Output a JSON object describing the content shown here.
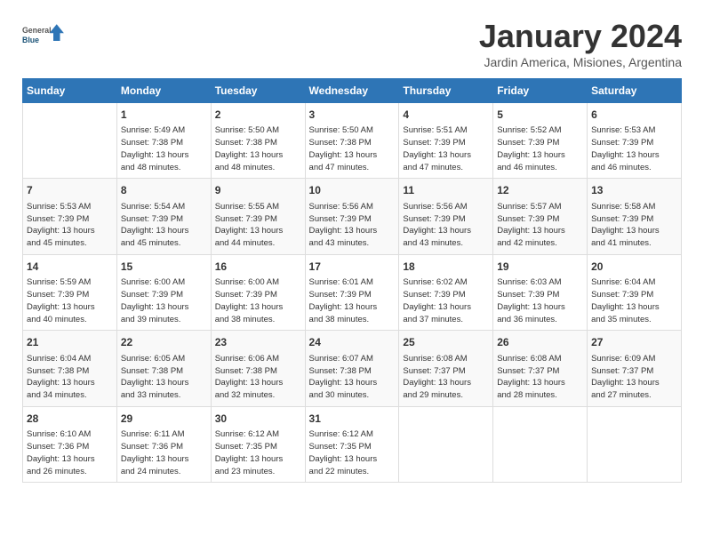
{
  "header": {
    "logo_general": "General",
    "logo_blue": "Blue",
    "month_title": "January 2024",
    "subtitle": "Jardin America, Misiones, Argentina"
  },
  "days_of_week": [
    "Sunday",
    "Monday",
    "Tuesday",
    "Wednesday",
    "Thursday",
    "Friday",
    "Saturday"
  ],
  "weeks": [
    [
      {
        "day": "",
        "sunrise": "",
        "sunset": "",
        "daylight": ""
      },
      {
        "day": "1",
        "sunrise": "5:49 AM",
        "sunset": "7:38 PM",
        "daylight": "13 hours and 48 minutes."
      },
      {
        "day": "2",
        "sunrise": "5:50 AM",
        "sunset": "7:38 PM",
        "daylight": "13 hours and 48 minutes."
      },
      {
        "day": "3",
        "sunrise": "5:50 AM",
        "sunset": "7:38 PM",
        "daylight": "13 hours and 47 minutes."
      },
      {
        "day": "4",
        "sunrise": "5:51 AM",
        "sunset": "7:39 PM",
        "daylight": "13 hours and 47 minutes."
      },
      {
        "day": "5",
        "sunrise": "5:52 AM",
        "sunset": "7:39 PM",
        "daylight": "13 hours and 46 minutes."
      },
      {
        "day": "6",
        "sunrise": "5:53 AM",
        "sunset": "7:39 PM",
        "daylight": "13 hours and 46 minutes."
      }
    ],
    [
      {
        "day": "7",
        "sunrise": "5:53 AM",
        "sunset": "7:39 PM",
        "daylight": "13 hours and 45 minutes."
      },
      {
        "day": "8",
        "sunrise": "5:54 AM",
        "sunset": "7:39 PM",
        "daylight": "13 hours and 45 minutes."
      },
      {
        "day": "9",
        "sunrise": "5:55 AM",
        "sunset": "7:39 PM",
        "daylight": "13 hours and 44 minutes."
      },
      {
        "day": "10",
        "sunrise": "5:56 AM",
        "sunset": "7:39 PM",
        "daylight": "13 hours and 43 minutes."
      },
      {
        "day": "11",
        "sunrise": "5:56 AM",
        "sunset": "7:39 PM",
        "daylight": "13 hours and 43 minutes."
      },
      {
        "day": "12",
        "sunrise": "5:57 AM",
        "sunset": "7:39 PM",
        "daylight": "13 hours and 42 minutes."
      },
      {
        "day": "13",
        "sunrise": "5:58 AM",
        "sunset": "7:39 PM",
        "daylight": "13 hours and 41 minutes."
      }
    ],
    [
      {
        "day": "14",
        "sunrise": "5:59 AM",
        "sunset": "7:39 PM",
        "daylight": "13 hours and 40 minutes."
      },
      {
        "day": "15",
        "sunrise": "6:00 AM",
        "sunset": "7:39 PM",
        "daylight": "13 hours and 39 minutes."
      },
      {
        "day": "16",
        "sunrise": "6:00 AM",
        "sunset": "7:39 PM",
        "daylight": "13 hours and 38 minutes."
      },
      {
        "day": "17",
        "sunrise": "6:01 AM",
        "sunset": "7:39 PM",
        "daylight": "13 hours and 38 minutes."
      },
      {
        "day": "18",
        "sunrise": "6:02 AM",
        "sunset": "7:39 PM",
        "daylight": "13 hours and 37 minutes."
      },
      {
        "day": "19",
        "sunrise": "6:03 AM",
        "sunset": "7:39 PM",
        "daylight": "13 hours and 36 minutes."
      },
      {
        "day": "20",
        "sunrise": "6:04 AM",
        "sunset": "7:39 PM",
        "daylight": "13 hours and 35 minutes."
      }
    ],
    [
      {
        "day": "21",
        "sunrise": "6:04 AM",
        "sunset": "7:38 PM",
        "daylight": "13 hours and 34 minutes."
      },
      {
        "day": "22",
        "sunrise": "6:05 AM",
        "sunset": "7:38 PM",
        "daylight": "13 hours and 33 minutes."
      },
      {
        "day": "23",
        "sunrise": "6:06 AM",
        "sunset": "7:38 PM",
        "daylight": "13 hours and 32 minutes."
      },
      {
        "day": "24",
        "sunrise": "6:07 AM",
        "sunset": "7:38 PM",
        "daylight": "13 hours and 30 minutes."
      },
      {
        "day": "25",
        "sunrise": "6:08 AM",
        "sunset": "7:37 PM",
        "daylight": "13 hours and 29 minutes."
      },
      {
        "day": "26",
        "sunrise": "6:08 AM",
        "sunset": "7:37 PM",
        "daylight": "13 hours and 28 minutes."
      },
      {
        "day": "27",
        "sunrise": "6:09 AM",
        "sunset": "7:37 PM",
        "daylight": "13 hours and 27 minutes."
      }
    ],
    [
      {
        "day": "28",
        "sunrise": "6:10 AM",
        "sunset": "7:36 PM",
        "daylight": "13 hours and 26 minutes."
      },
      {
        "day": "29",
        "sunrise": "6:11 AM",
        "sunset": "7:36 PM",
        "daylight": "13 hours and 24 minutes."
      },
      {
        "day": "30",
        "sunrise": "6:12 AM",
        "sunset": "7:35 PM",
        "daylight": "13 hours and 23 minutes."
      },
      {
        "day": "31",
        "sunrise": "6:12 AM",
        "sunset": "7:35 PM",
        "daylight": "13 hours and 22 minutes."
      },
      {
        "day": "",
        "sunrise": "",
        "sunset": "",
        "daylight": ""
      },
      {
        "day": "",
        "sunrise": "",
        "sunset": "",
        "daylight": ""
      },
      {
        "day": "",
        "sunrise": "",
        "sunset": "",
        "daylight": ""
      }
    ]
  ],
  "labels": {
    "sunrise": "Sunrise:",
    "sunset": "Sunset:",
    "daylight": "Daylight:"
  }
}
